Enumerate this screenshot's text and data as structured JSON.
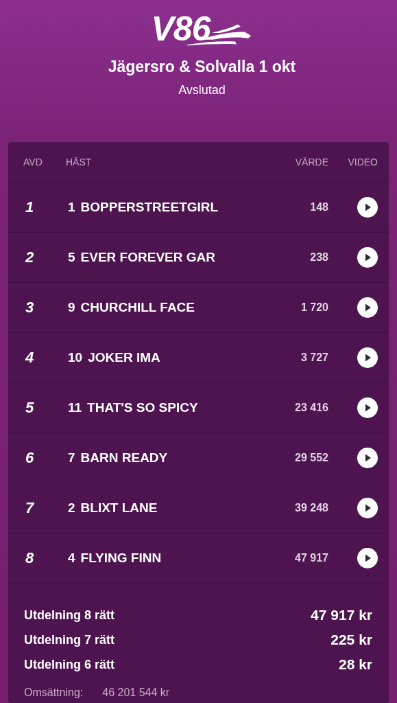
{
  "header": {
    "logo": "V86",
    "title": "Jägersro & Solvalla 1 okt",
    "status": "Avslutad"
  },
  "table": {
    "columns": [
      "AVD",
      "HÄST",
      "VÄRDE",
      "VIDEO"
    ],
    "rows": [
      {
        "avd": "1",
        "number": "1",
        "horse": "BOPPERSTREETGIRL",
        "value": "148"
      },
      {
        "avd": "2",
        "number": "5",
        "horse": "EVER FOREVER GAR",
        "value": "238"
      },
      {
        "avd": "3",
        "number": "9",
        "horse": "CHURCHILL FACE",
        "value": "1 720"
      },
      {
        "avd": "4",
        "number": "10",
        "horse": "JOKER IMA",
        "value": "3 727"
      },
      {
        "avd": "5",
        "number": "11",
        "horse": "THAT'S SO SPICY",
        "value": "23 416"
      },
      {
        "avd": "6",
        "number": "7",
        "horse": "BARN READY",
        "value": "29 552"
      },
      {
        "avd": "7",
        "number": "2",
        "horse": "BLIXT LANE",
        "value": "39 248"
      },
      {
        "avd": "8",
        "number": "4",
        "horse": "FLYING FINN",
        "value": "47 917"
      }
    ]
  },
  "payouts": [
    {
      "label": "Utdelning 8 rätt",
      "amount": "47 917 kr"
    },
    {
      "label": "Utdelning 7 rätt",
      "amount": "225 kr"
    },
    {
      "label": "Utdelning 6 rätt",
      "amount": "28 kr"
    }
  ],
  "turnover": {
    "label": "Omsättning:",
    "amount": "46 201 544 kr"
  }
}
